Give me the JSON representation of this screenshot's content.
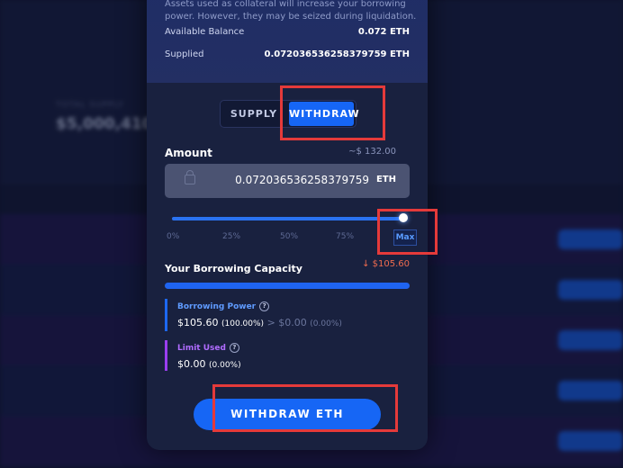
{
  "background": {
    "stat_label": "TOTAL SUPPLY",
    "stat_value": "$5,000,410"
  },
  "modal": {
    "note": "Assets used as collateral will increase your borrowing power. However, they may be seized during liquidation.",
    "available_balance_label": "Available Balance",
    "available_balance_value": "0.072 ETH",
    "supplied_label": "Supplied",
    "supplied_value": "0.072036536258379759 ETH",
    "tabs": {
      "supply": "SUPPLY",
      "withdraw": "WITHDRAW",
      "active": "withdraw"
    },
    "amount_label": "Amount",
    "amount_usd": "~$ 132.00",
    "amount_value": "0.072036536258379759",
    "amount_unit": "ETH",
    "slider": {
      "percent": 100,
      "ticks": [
        "0%",
        "25%",
        "50%",
        "75%"
      ],
      "max_label": "Max"
    },
    "capacity_title": "Your Borrowing Capacity",
    "capacity_change": "↓ $105.60",
    "capacity_fill_percent": 100,
    "borrowing_power": {
      "label": "Borrowing Power",
      "current": "$105.60",
      "current_pct": "(100.00%)",
      "arrow": ">",
      "next": "$0.00",
      "next_pct": "(0.00%)"
    },
    "limit_used": {
      "label": "Limit Used",
      "value": "$0.00",
      "pct": "(0.00%)"
    },
    "info_glyph": "?",
    "withdraw_button": "WITHDRAW ETH"
  },
  "colors": {
    "accent": "#1666f5",
    "annotation": "#e53a3a",
    "limit_purple": "#9a3ef0",
    "decrease": "#ef6b4f"
  }
}
